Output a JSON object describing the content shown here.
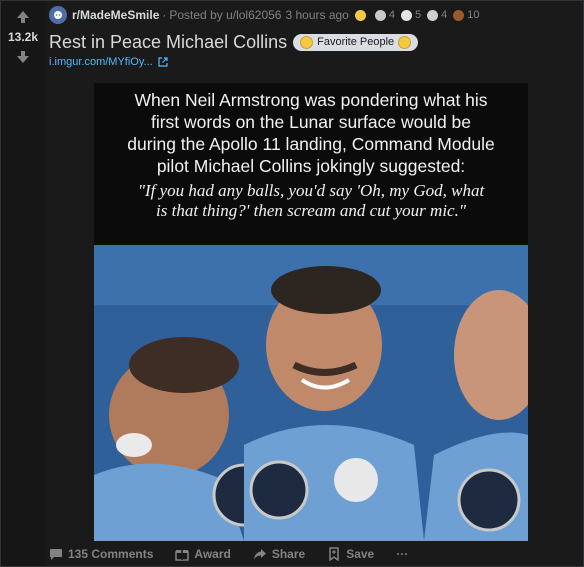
{
  "votes": {
    "score": "13.2k"
  },
  "post": {
    "subreddit": "r/MadeMeSmile",
    "posted_by": "Posted by u/lol62056",
    "time": "3 hours ago",
    "awards": [
      {
        "icon": "silver-award-icon",
        "color": "#f5c842",
        "count": ""
      },
      {
        "icon": "helpful-award-icon",
        "color": "#c8c8c8",
        "count": "4"
      },
      {
        "icon": "wholesome-award-icon",
        "color": "#e6e6e6",
        "count": "5"
      },
      {
        "icon": "rocket-award-icon",
        "color": "#cfcfcf",
        "count": "4"
      },
      {
        "icon": "poop-award-icon",
        "color": "#9a5a2a",
        "count": "10"
      }
    ],
    "title": "Rest in Peace Michael Collins",
    "flair": "Favorite People",
    "link": "i.imgur.com/MYfiOy..."
  },
  "image_caption": {
    "lines": [
      "When Neil Armstrong was pondering what his",
      "first words on the Lunar surface would be",
      "during the Apollo 11 landing, Command Module",
      "pilot Michael Collins jokingly suggested:"
    ],
    "quote_lines": [
      "\"If you had any balls, you'd say 'Oh, my God, what",
      "is that thing?' then scream and cut your mic.\""
    ]
  },
  "actions": {
    "comments": "135 Comments",
    "award": "Award",
    "share": "Share",
    "save": "Save",
    "more": "···"
  },
  "colors": {
    "background": "#1a1a1b",
    "link": "#4fbcff",
    "muted": "#818384"
  }
}
